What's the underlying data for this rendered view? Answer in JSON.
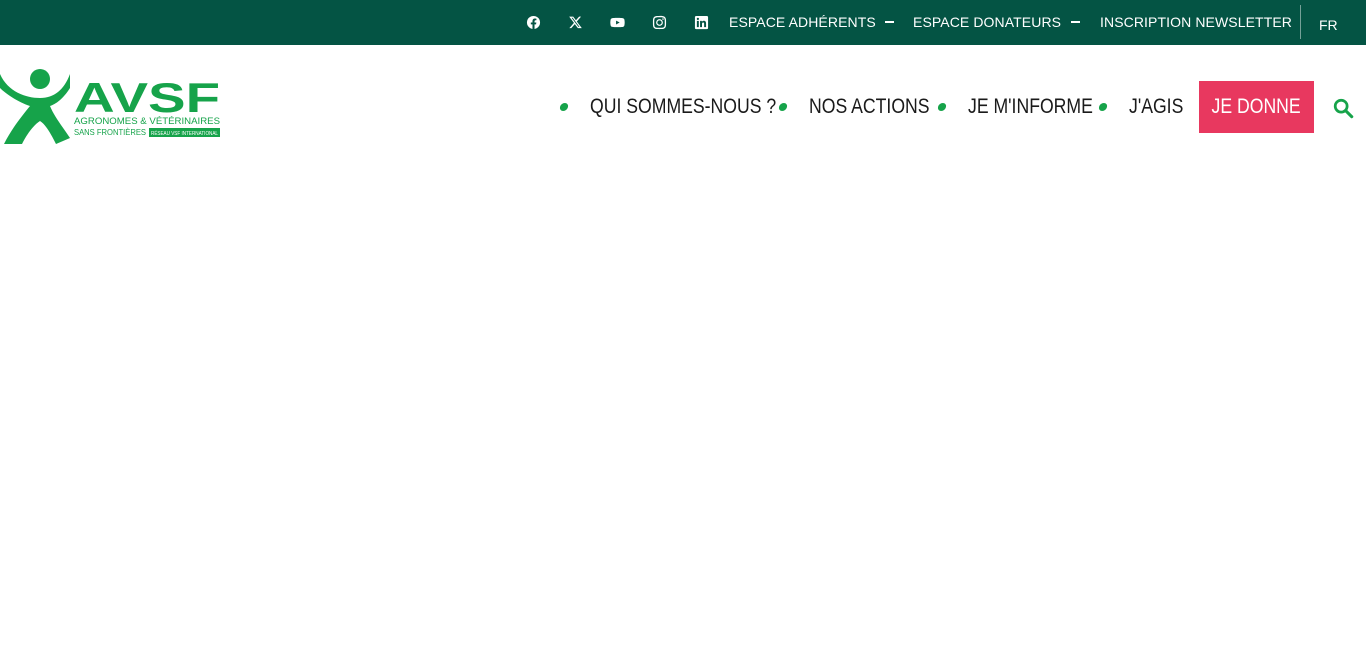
{
  "topbar": {
    "background": "#045444",
    "social": [
      "facebook-icon",
      "x-icon",
      "youtube-icon",
      "instagram-icon",
      "linkedin-icon"
    ],
    "links": [
      "ESPACE ADHÉRENTS",
      "ESPACE DONATEURS",
      "INSCRIPTION NEWSLETTER"
    ],
    "language": "FR"
  },
  "logo": {
    "wordmark": "AVSF",
    "tagline_line1": "AGRONOMES & VÉTÉRINAIRES",
    "tagline_line2": "SANS FRONTIÈRES",
    "network_badge": "RÉSEAU VSF INTERNATIONAL",
    "brand_color": "#16a34a"
  },
  "nav": {
    "items": [
      "QUI SOMMES-NOUS ?",
      "NOS ACTIONS",
      "JE M'INFORME",
      "J'AGIS"
    ],
    "bullet_color": "#16a34a"
  },
  "donate": {
    "label": "JE DONNE",
    "color": "#e8385f"
  },
  "search": {
    "icon": "search-icon",
    "color": "#16a34a"
  }
}
